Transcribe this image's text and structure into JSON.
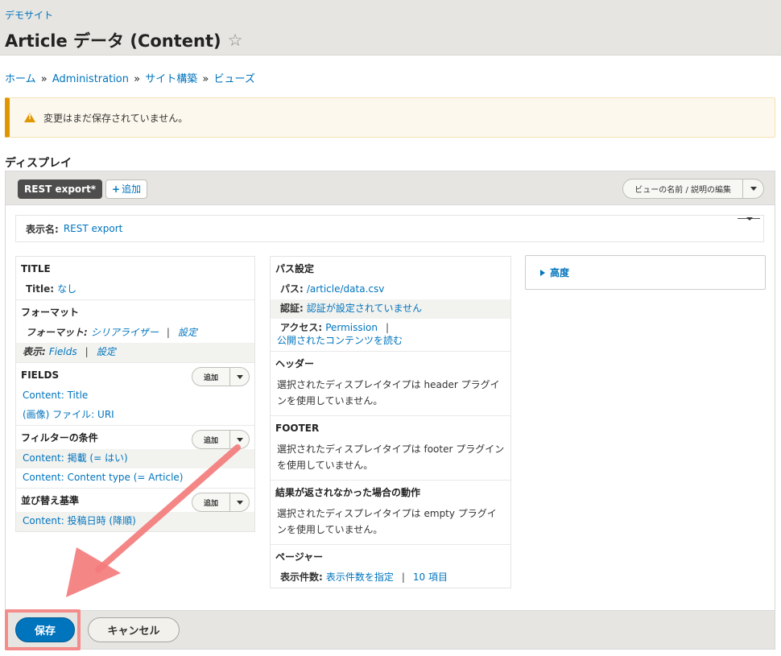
{
  "header": {
    "site_name": "デモサイト",
    "title": "Article データ (Content)"
  },
  "breadcrumb": [
    "ホーム",
    "Administration",
    "サイト構築",
    "ビューズ"
  ],
  "breadcrumb_sep": "»",
  "warning": "変更はまだ保存されていません。",
  "section_title": "ディスプレイ",
  "tabs": {
    "active": "REST export*",
    "add": "追加",
    "edit_name": "ビューの名前 / 説明の編集"
  },
  "display_name": {
    "label": "表示名:",
    "value": "REST export"
  },
  "col1": {
    "title": {
      "head": "TITLE",
      "label": "Title:",
      "value": "なし"
    },
    "format": {
      "head": "フォーマット",
      "format_label": "フォーマット:",
      "format_value": "シリアライザー",
      "format_settings": "設定",
      "show_label": "表示:",
      "show_value": "Fields",
      "show_settings": "設定"
    },
    "fields": {
      "head": "FIELDS",
      "add": "追加",
      "items": [
        "Content: Title",
        "(画像) ファイル: URI"
      ]
    },
    "filters": {
      "head": "フィルターの条件",
      "add": "追加",
      "items": [
        "Content: 掲載 (= はい)",
        "Content: Content type (= Article)"
      ]
    },
    "sort": {
      "head": "並び替え基準",
      "add": "追加",
      "items": [
        "Content: 投稿日時 (降順)"
      ]
    }
  },
  "col2": {
    "path": {
      "head": "パス設定",
      "path_label": "パス:",
      "path_value": "/article/data.csv",
      "auth_label": "認証:",
      "auth_value": "認証が設定されていません",
      "access_label": "アクセス:",
      "access_value": "Permission",
      "access_value2": "公開されたコンテンツを読む"
    },
    "header": {
      "head": "ヘッダー",
      "desc": "選択されたディスプレイタイプは header プラグインを使用していません。"
    },
    "footer": {
      "head": "FOOTER",
      "desc": "選択されたディスプレイタイプは footer プラグインを使用していません。"
    },
    "empty": {
      "head": "結果が返されなかった場合の動作",
      "desc": "選択されたディスプレイタイプは empty プラグインを使用していません。"
    },
    "pager": {
      "head": "ページャー",
      "label": "表示件数:",
      "value": "表示件数を指定",
      "value2": "10 項目"
    }
  },
  "advanced": "高度",
  "actions": {
    "save": "保存",
    "cancel": "キャンセル"
  },
  "colors": {
    "link": "#0074bd",
    "warning_accent": "#e09600",
    "annotation_arrow": "#f47c7c"
  }
}
